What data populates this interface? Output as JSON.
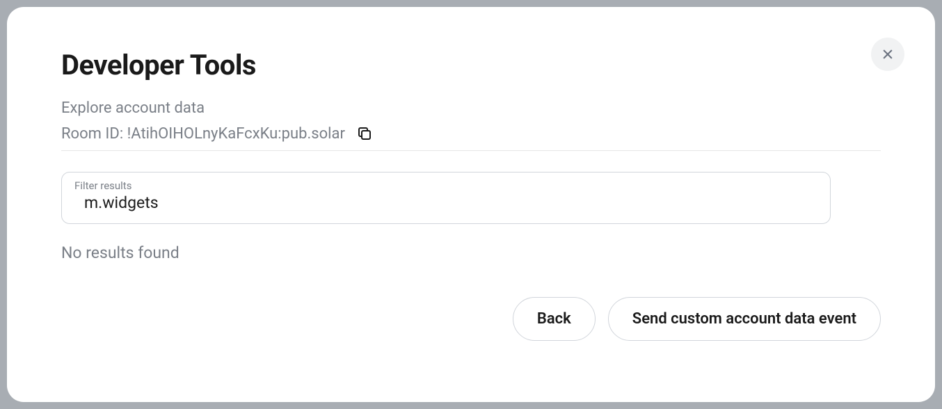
{
  "title": "Developer Tools",
  "subtitle": "Explore account data",
  "room_id_label": "Room ID: ",
  "room_id_value": "!AtihOIHOLnyKaFcxKu:pub.solar",
  "filter": {
    "label": "Filter results",
    "value": "m.widgets"
  },
  "no_results": "No results found",
  "buttons": {
    "back": "Back",
    "send": "Send custom account data event"
  }
}
